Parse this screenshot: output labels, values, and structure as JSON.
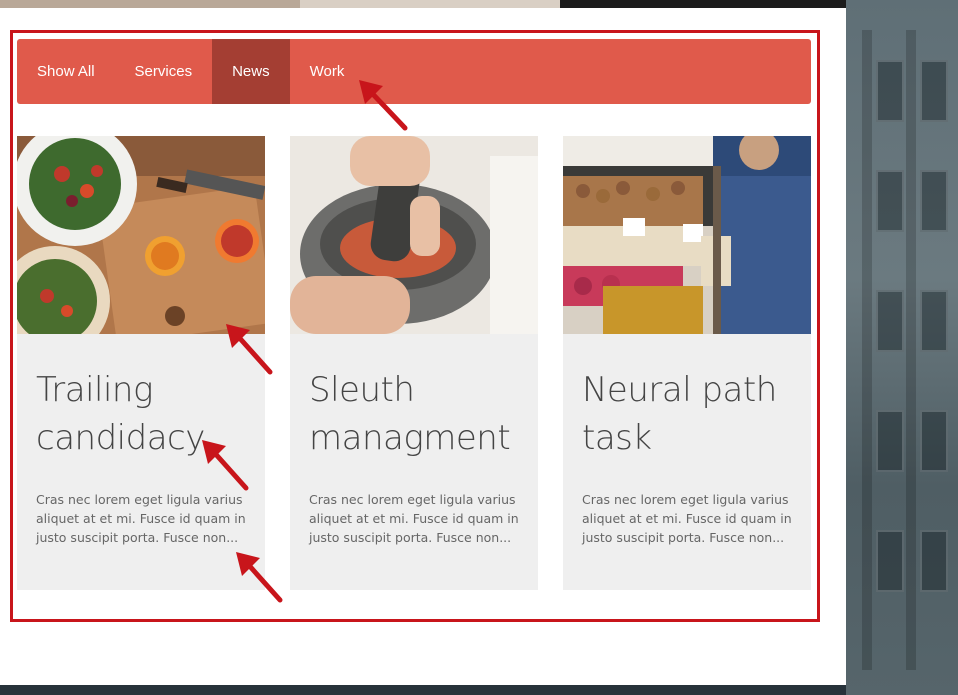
{
  "filter_nav": {
    "tabs": [
      {
        "label": "Show All",
        "active": false
      },
      {
        "label": "Services",
        "active": false
      },
      {
        "label": "News",
        "active": true
      },
      {
        "label": "Work",
        "active": false
      }
    ]
  },
  "cards": [
    {
      "title_line1": "Trailing",
      "title_line2": "candidacy",
      "excerpt": "Cras nec lorem eget ligula varius aliquet at et mi. Fusce id quam in justo suscipit porta. Fusce non..."
    },
    {
      "title_line1": "Sleuth",
      "title_line2": "managment",
      "excerpt": "Cras nec lorem eget ligula varius aliquet at et mi. Fusce id quam in justo suscipit porta. Fusce non..."
    },
    {
      "title_line1": "Neural path",
      "title_line2": "task",
      "excerpt": "Cras nec lorem eget ligula varius aliquet at et mi. Fusce id quam in justo suscipit porta. Fusce non..."
    }
  ],
  "colors": {
    "nav_bg": "#e05a4b",
    "nav_active": "#a43e33",
    "highlight": "#c8151b",
    "card_bg": "#efefef"
  }
}
